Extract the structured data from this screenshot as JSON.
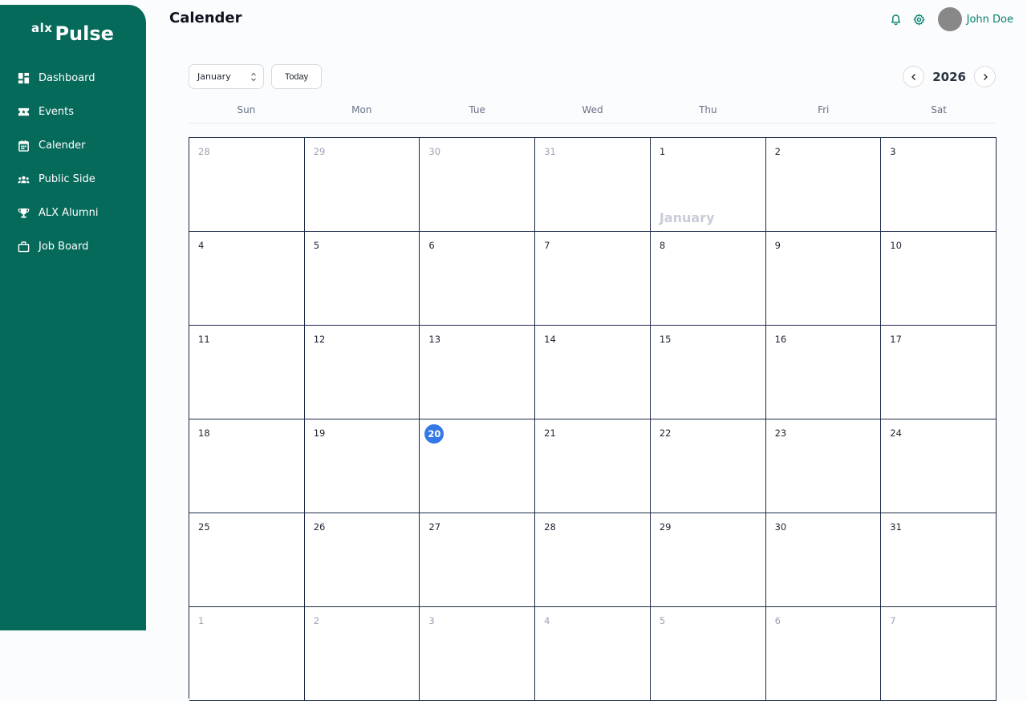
{
  "brand": {
    "logo_small": "alx",
    "logo_main": "Pulse"
  },
  "sidebar": {
    "items": [
      {
        "label": "Dashboard",
        "icon": "dashboard-icon"
      },
      {
        "label": "Events",
        "icon": "ticket-icon"
      },
      {
        "label": "Calender",
        "icon": "calendar-icon"
      },
      {
        "label": "Public Side",
        "icon": "people-icon"
      },
      {
        "label": "ALX Alumni",
        "icon": "trophy-icon"
      },
      {
        "label": "Job Board",
        "icon": "briefcase-icon"
      }
    ]
  },
  "header": {
    "title": "Calender",
    "user_name": "John Doe",
    "icons": [
      "bell-icon",
      "gear-icon",
      "avatar"
    ]
  },
  "controls": {
    "month_selected": "January",
    "today_label": "Today",
    "year": "2026"
  },
  "weekdays": [
    "Sun",
    "Mon",
    "Tue",
    "Wed",
    "Thu",
    "Fri",
    "Sat"
  ],
  "calendar": {
    "month_watermark": "January",
    "today": "20",
    "weeks": [
      [
        {
          "d": "28",
          "other": true
        },
        {
          "d": "29",
          "other": true
        },
        {
          "d": "30",
          "other": true
        },
        {
          "d": "31",
          "other": true
        },
        {
          "d": "1",
          "label": "January"
        },
        {
          "d": "2"
        },
        {
          "d": "3"
        }
      ],
      [
        {
          "d": "4"
        },
        {
          "d": "5"
        },
        {
          "d": "6"
        },
        {
          "d": "7"
        },
        {
          "d": "8"
        },
        {
          "d": "9"
        },
        {
          "d": "10"
        }
      ],
      [
        {
          "d": "11"
        },
        {
          "d": "12"
        },
        {
          "d": "13"
        },
        {
          "d": "14"
        },
        {
          "d": "15"
        },
        {
          "d": "16"
        },
        {
          "d": "17"
        }
      ],
      [
        {
          "d": "18"
        },
        {
          "d": "19"
        },
        {
          "d": "20",
          "today": true
        },
        {
          "d": "21"
        },
        {
          "d": "22"
        },
        {
          "d": "23"
        },
        {
          "d": "24"
        }
      ],
      [
        {
          "d": "25"
        },
        {
          "d": "26"
        },
        {
          "d": "27"
        },
        {
          "d": "28"
        },
        {
          "d": "29"
        },
        {
          "d": "30"
        },
        {
          "d": "31"
        }
      ],
      [
        {
          "d": "1",
          "other": true
        },
        {
          "d": "2",
          "other": true
        },
        {
          "d": "3",
          "other": true
        },
        {
          "d": "4",
          "other": true
        },
        {
          "d": "5",
          "other": true
        },
        {
          "d": "6",
          "other": true
        },
        {
          "d": "7",
          "other": true
        }
      ]
    ]
  },
  "colors": {
    "sidebar_bg": "#066a5b",
    "accent_green": "#06806e",
    "today_blue": "#3478e5",
    "grid_border": "#1c2a47"
  }
}
